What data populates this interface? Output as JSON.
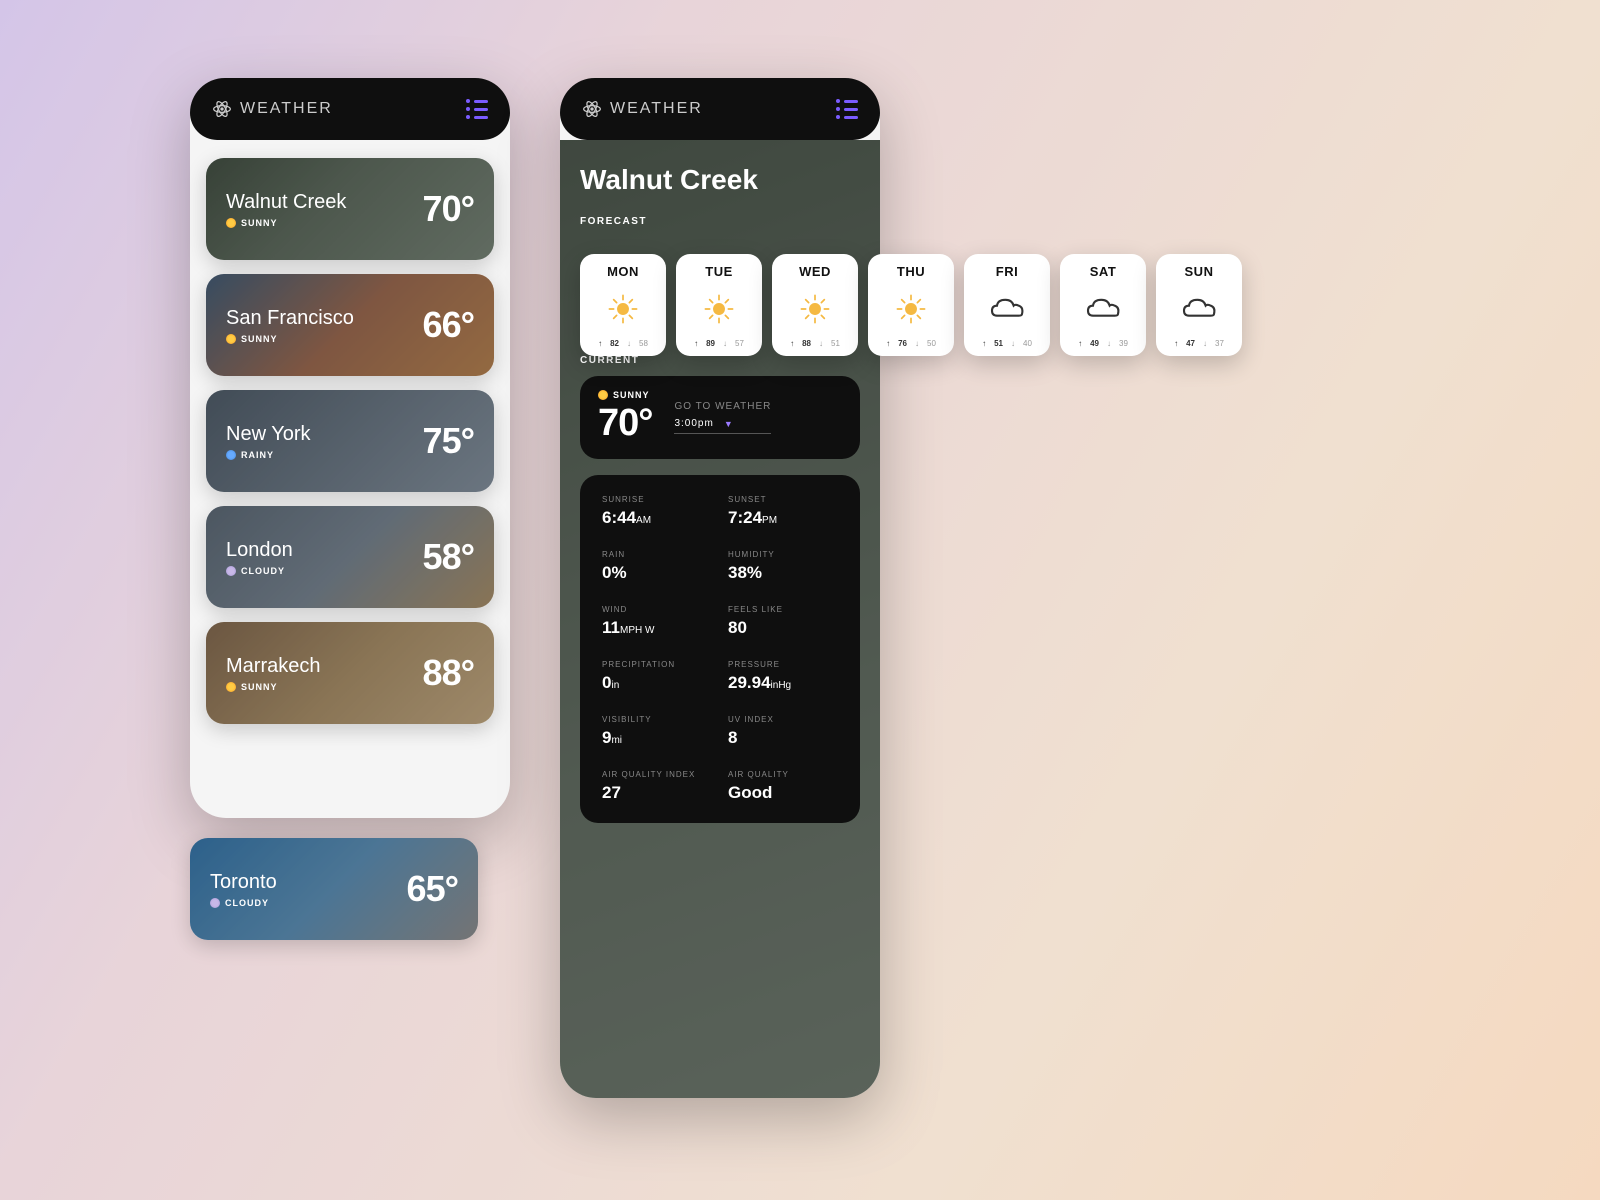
{
  "app": {
    "title": "WEATHER"
  },
  "cities": [
    {
      "name": "Walnut Creek",
      "condition": "SUNNY",
      "cond_type": "sunny",
      "temp": "70°"
    },
    {
      "name": "San Francisco",
      "condition": "SUNNY",
      "cond_type": "sunny",
      "temp": "66°"
    },
    {
      "name": "New York",
      "condition": "RAINY",
      "cond_type": "rainy",
      "temp": "75°"
    },
    {
      "name": "London",
      "condition": "CLOUDY",
      "cond_type": "cloudy",
      "temp": "58°"
    },
    {
      "name": "Marrakech",
      "condition": "SUNNY",
      "cond_type": "sunny",
      "temp": "88°"
    },
    {
      "name": "Toronto",
      "condition": "CLOUDY",
      "cond_type": "cloudy",
      "temp": "65°"
    }
  ],
  "detail": {
    "city": "Walnut Creek",
    "forecast_label": "FORECAST",
    "current_label": "CURRENT",
    "forecast": [
      {
        "day": "MON",
        "icon": "sun",
        "hi": "82",
        "lo": "58"
      },
      {
        "day": "TUE",
        "icon": "sun",
        "hi": "89",
        "lo": "57"
      },
      {
        "day": "WED",
        "icon": "sun",
        "hi": "88",
        "lo": "51"
      },
      {
        "day": "THU",
        "icon": "sun",
        "hi": "76",
        "lo": "50"
      },
      {
        "day": "FRI",
        "icon": "cloud",
        "hi": "51",
        "lo": "40"
      },
      {
        "day": "SAT",
        "icon": "cloud",
        "hi": "49",
        "lo": "39"
      },
      {
        "day": "SUN",
        "icon": "cloud",
        "hi": "47",
        "lo": "37"
      }
    ],
    "current": {
      "condition": "SUNNY",
      "temp": "70°",
      "goto_label": "GO TO WEATHER",
      "time": "3:00pm"
    },
    "stats": {
      "sunrise": {
        "label": "SUNRISE",
        "value": "6:44",
        "unit": "AM"
      },
      "sunset": {
        "label": "SUNSET",
        "value": "7:24",
        "unit": "PM"
      },
      "rain": {
        "label": "RAIN",
        "value": "0%",
        "unit": ""
      },
      "humidity": {
        "label": "HUMIDITY",
        "value": "38%",
        "unit": ""
      },
      "wind": {
        "label": "WIND",
        "value": "11",
        "unit": "MPH W"
      },
      "feels": {
        "label": "FEELS LIKE",
        "value": "80",
        "unit": ""
      },
      "precip": {
        "label": "PRECIPITATION",
        "value": "0",
        "unit": "in"
      },
      "pressure": {
        "label": "PRESSURE",
        "value": "29.94",
        "unit": "inHg"
      },
      "visibility": {
        "label": "VISIBILITY",
        "value": "9",
        "unit": "mi"
      },
      "uv": {
        "label": "UV INDEX",
        "value": "8",
        "unit": ""
      },
      "aqi": {
        "label": "AIR QUALITY INDEX",
        "value": "27",
        "unit": ""
      },
      "aq": {
        "label": "AIR QUALITY",
        "value": "Good",
        "unit": ""
      }
    }
  }
}
